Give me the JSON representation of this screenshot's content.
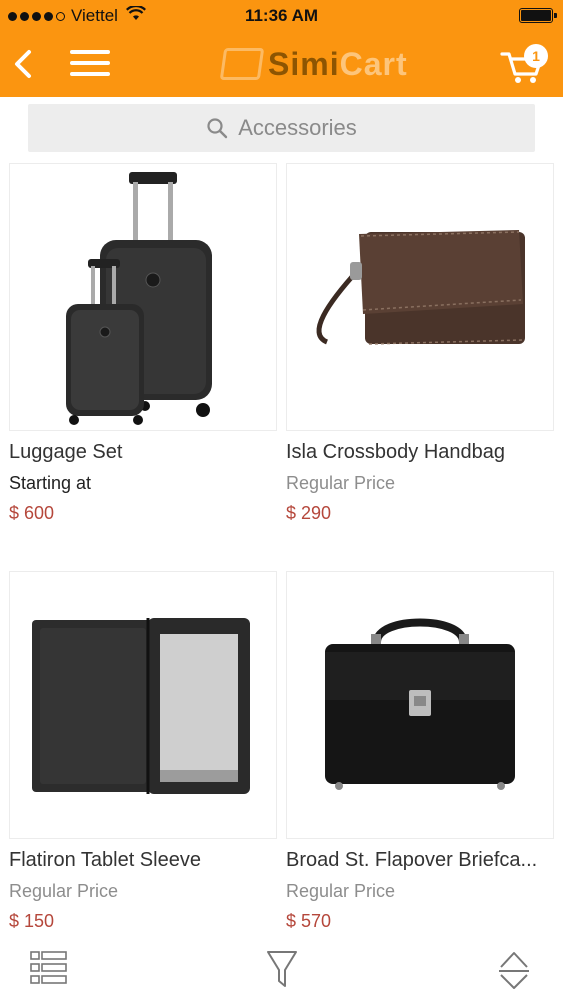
{
  "status_bar": {
    "carrier": "Viettel",
    "time": "11:36 AM"
  },
  "header": {
    "logo_part1": "Simi",
    "logo_part2": "Cart",
    "cart_count": "1",
    "icons": [
      "back-arrow-icon",
      "hamburger-menu-icon",
      "cart-icon"
    ],
    "background": "#fb9510"
  },
  "search": {
    "placeholder": "Accessories"
  },
  "products": [
    {
      "name": "Luggage Set",
      "price_label": "Starting at",
      "price": "$ 600"
    },
    {
      "name": "Isla Crossbody Handbag",
      "price_label": "Regular Price",
      "price": "$ 290"
    },
    {
      "name": "Flatiron Tablet Sleeve",
      "price_label": "Regular Price",
      "price": "$ 150"
    },
    {
      "name": "Broad St. Flapover Briefca...",
      "price_label": "Regular Price",
      "price": "$ 570"
    }
  ],
  "bottom_bar": {
    "icons": [
      "list-view-icon",
      "filter-icon",
      "sort-icon"
    ]
  },
  "colors": {
    "accent": "#fb9510",
    "price": "#b5473b"
  }
}
